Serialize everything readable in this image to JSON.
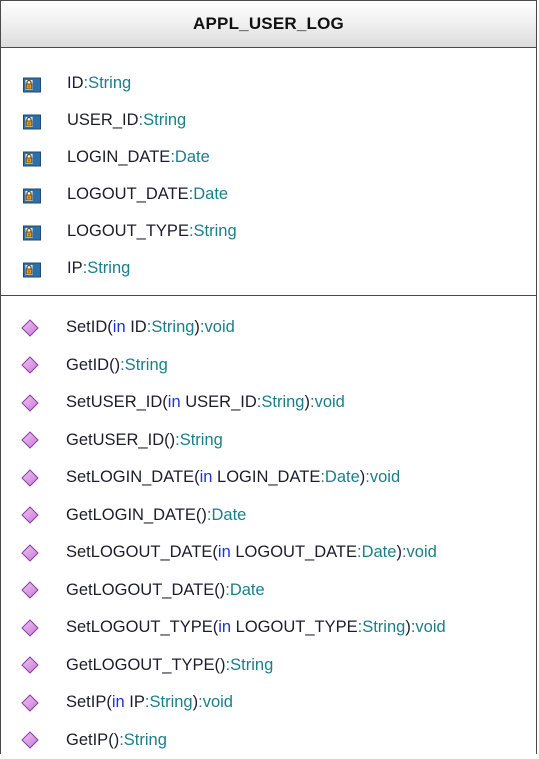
{
  "class_box": {
    "name": "APPL_USER_LOG"
  },
  "attributes": [
    {
      "name": "ID",
      "type": "String",
      "icon": "private-attribute-icon"
    },
    {
      "name": "USER_ID",
      "type": "String",
      "icon": "private-attribute-icon"
    },
    {
      "name": "LOGIN_DATE",
      "type": "Date",
      "icon": "private-attribute-icon"
    },
    {
      "name": "LOGOUT_DATE",
      "type": "Date",
      "icon": "private-attribute-icon"
    },
    {
      "name": "LOGOUT_TYPE",
      "type": "String",
      "icon": "private-attribute-icon"
    },
    {
      "name": "IP",
      "type": "String",
      "icon": "private-attribute-icon"
    }
  ],
  "operations": [
    {
      "name": "SetID",
      "param_dir": "in",
      "param_name": "ID",
      "param_type": "String",
      "return_type": "void",
      "icon": "public-operation-icon"
    },
    {
      "name": "GetID",
      "param_dir": "",
      "param_name": "",
      "param_type": "",
      "return_type": "String",
      "icon": "public-operation-icon"
    },
    {
      "name": "SetUSER_ID",
      "param_dir": "in",
      "param_name": "USER_ID",
      "param_type": "String",
      "return_type": "void",
      "icon": "public-operation-icon"
    },
    {
      "name": "GetUSER_ID",
      "param_dir": "",
      "param_name": "",
      "param_type": "",
      "return_type": "String",
      "icon": "public-operation-icon"
    },
    {
      "name": "SetLOGIN_DATE",
      "param_dir": "in",
      "param_name": "LOGIN_DATE",
      "param_type": "Date",
      "return_type": "void",
      "icon": "public-operation-icon"
    },
    {
      "name": "GetLOGIN_DATE",
      "param_dir": "",
      "param_name": "",
      "param_type": "",
      "return_type": "Date",
      "icon": "public-operation-icon"
    },
    {
      "name": "SetLOGOUT_DATE",
      "param_dir": "in",
      "param_name": "LOGOUT_DATE",
      "param_type": "Date",
      "return_type": "void",
      "icon": "public-operation-icon"
    },
    {
      "name": "GetLOGOUT_DATE",
      "param_dir": "",
      "param_name": "",
      "param_type": "",
      "return_type": "Date",
      "icon": "public-operation-icon"
    },
    {
      "name": "SetLOGOUT_TYPE",
      "param_dir": "in",
      "param_name": "LOGOUT_TYPE",
      "param_type": "String",
      "return_type": "void",
      "icon": "public-operation-icon"
    },
    {
      "name": "GetLOGOUT_TYPE",
      "param_dir": "",
      "param_name": "",
      "param_type": "",
      "return_type": "String",
      "icon": "public-operation-icon"
    },
    {
      "name": "SetIP",
      "param_dir": "in",
      "param_name": "IP",
      "param_type": "String",
      "return_type": "void",
      "icon": "public-operation-icon"
    },
    {
      "name": "GetIP",
      "param_dir": "",
      "param_name": "",
      "param_type": "",
      "return_type": "String",
      "icon": "public-operation-icon"
    }
  ],
  "colors": {
    "type_color": "#1a7f8a",
    "keyword_color": "#1f33d6",
    "name_color": "#1d1d2b",
    "attribute_icon_color": "#2f6fa8",
    "attribute_lock_color": "#e5a020",
    "operation_icon_color": "#c779d6"
  }
}
